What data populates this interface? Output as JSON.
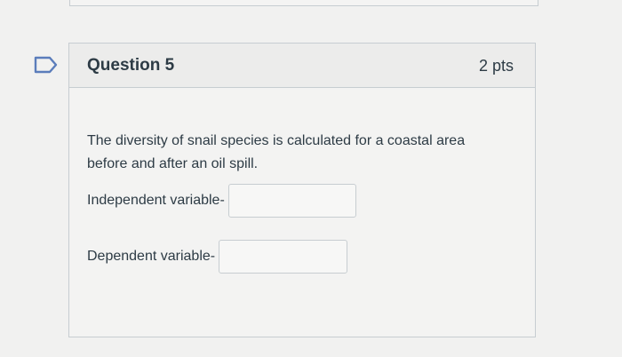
{
  "question": {
    "title": "Question 5",
    "points": "2 pts",
    "text": "The diversity of snail species is calculated for a coastal area before and after an oil spill.",
    "fields": [
      {
        "label": "Independent variable-",
        "value": ""
      },
      {
        "label": "Dependent variable-",
        "value": ""
      }
    ]
  },
  "colors": {
    "border": "#c7cdd1",
    "text": "#2d3b45",
    "flag": "#5b7dbb"
  },
  "icons": {
    "flag": "bookmark-flag-icon"
  }
}
